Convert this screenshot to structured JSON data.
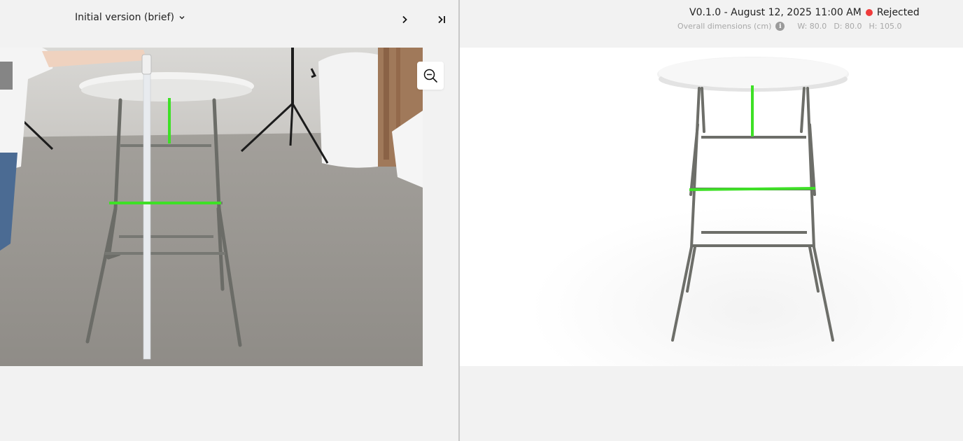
{
  "left_panel": {
    "version_select_label": "Initial version (brief)",
    "nav_next_icon": "chevron-right-icon",
    "nav_last_icon": "skip-to-end-icon",
    "zoom_icon": "zoom-out-icon",
    "photo": {
      "subject": "reference-photo-bar-table",
      "measure_lines_color": "#3ee026"
    }
  },
  "right_panel": {
    "version_label": "V0.1.0 - August 12, 2025 11:00 AM",
    "status_text": "Rejected",
    "status_color": "#ef3b3b",
    "dimensions_label": "Overall dimensions (cm)",
    "info_icon": "info-icon",
    "width": "W: 80.0",
    "depth": "D: 80.0",
    "height": "H: 105.0",
    "render": {
      "subject": "3d-render-bar-table",
      "measure_lines_color": "#3ee026"
    }
  }
}
